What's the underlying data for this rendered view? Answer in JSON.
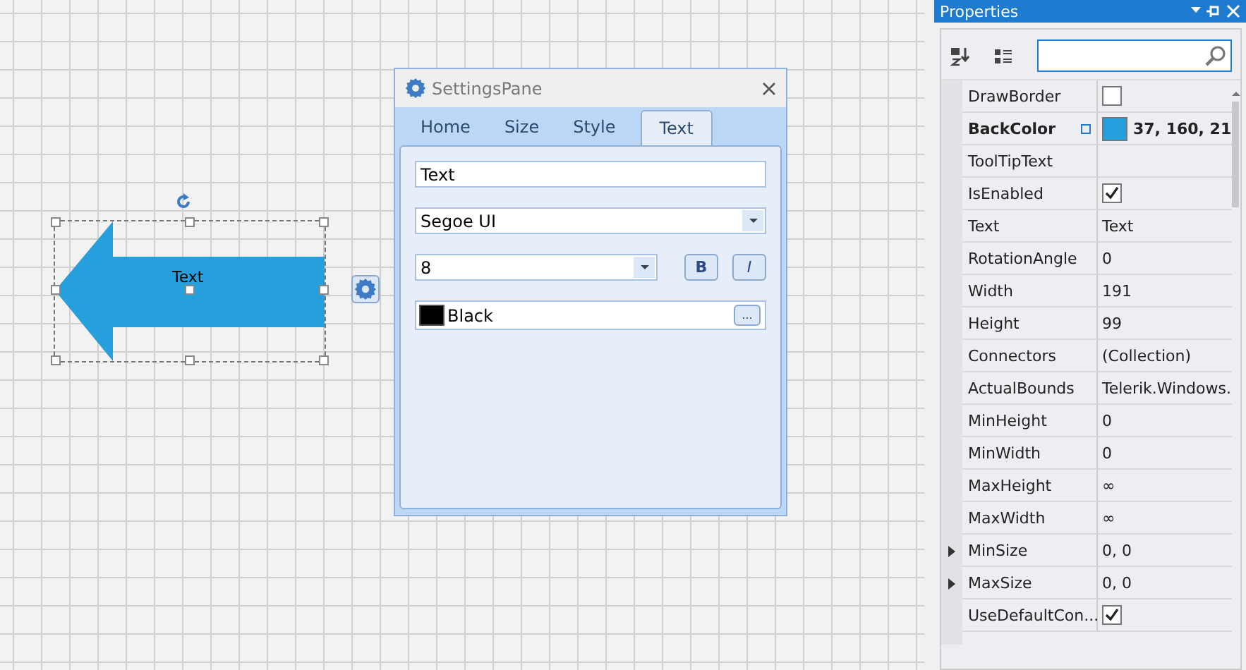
{
  "diagram": {
    "shape": {
      "text": "Text",
      "color": "#25a0dd",
      "selected": true
    }
  },
  "settings_pane": {
    "title": "SettingsPane",
    "tabs": [
      {
        "label": "Home",
        "selected": false
      },
      {
        "label": "Size",
        "selected": false
      },
      {
        "label": "Style",
        "selected": false
      },
      {
        "label": "Text",
        "selected": true
      }
    ],
    "text_value": "Text",
    "font": "Segoe UI",
    "font_size": "8",
    "bold_label": "B",
    "italic_label": "I",
    "color_picker": {
      "name": "Black",
      "color": "#000000"
    },
    "more_label": "..."
  },
  "properties": {
    "title": "Properties",
    "rows": [
      {
        "name": "DrawBorder",
        "kind": "checkbox",
        "checked": false
      },
      {
        "name": "BackColor",
        "kind": "color",
        "value": "37, 160, 21",
        "color": "#25a0dd",
        "modified": true
      },
      {
        "name": "ToolTipText",
        "kind": "text"
      },
      {
        "name": "IsEnabled",
        "kind": "checkbox",
        "checked": true
      },
      {
        "name": "Text",
        "kind": "text",
        "value": "Text"
      },
      {
        "name": "RotationAngle",
        "kind": "text",
        "value": "0"
      },
      {
        "name": "Width",
        "kind": "text",
        "value": "191"
      },
      {
        "name": "Height",
        "kind": "text",
        "value": "99"
      },
      {
        "name": "Connectors",
        "kind": "text",
        "value": "(Collection)"
      },
      {
        "name": "ActualBounds",
        "kind": "text",
        "value": "Telerik.Windows."
      },
      {
        "name": "MinHeight",
        "kind": "text",
        "value": "0"
      },
      {
        "name": "MinWidth",
        "kind": "text",
        "value": "0"
      },
      {
        "name": "MaxHeight",
        "kind": "text",
        "value": "∞"
      },
      {
        "name": "MaxWidth",
        "kind": "text",
        "value": "∞"
      },
      {
        "name": "MinSize",
        "kind": "text",
        "value": "0, 0",
        "expandable": true
      },
      {
        "name": "MaxSize",
        "kind": "text",
        "value": "0, 0",
        "expandable": true
      },
      {
        "name": "UseDefaultCon...",
        "kind": "checkbox",
        "checked": true
      }
    ]
  }
}
